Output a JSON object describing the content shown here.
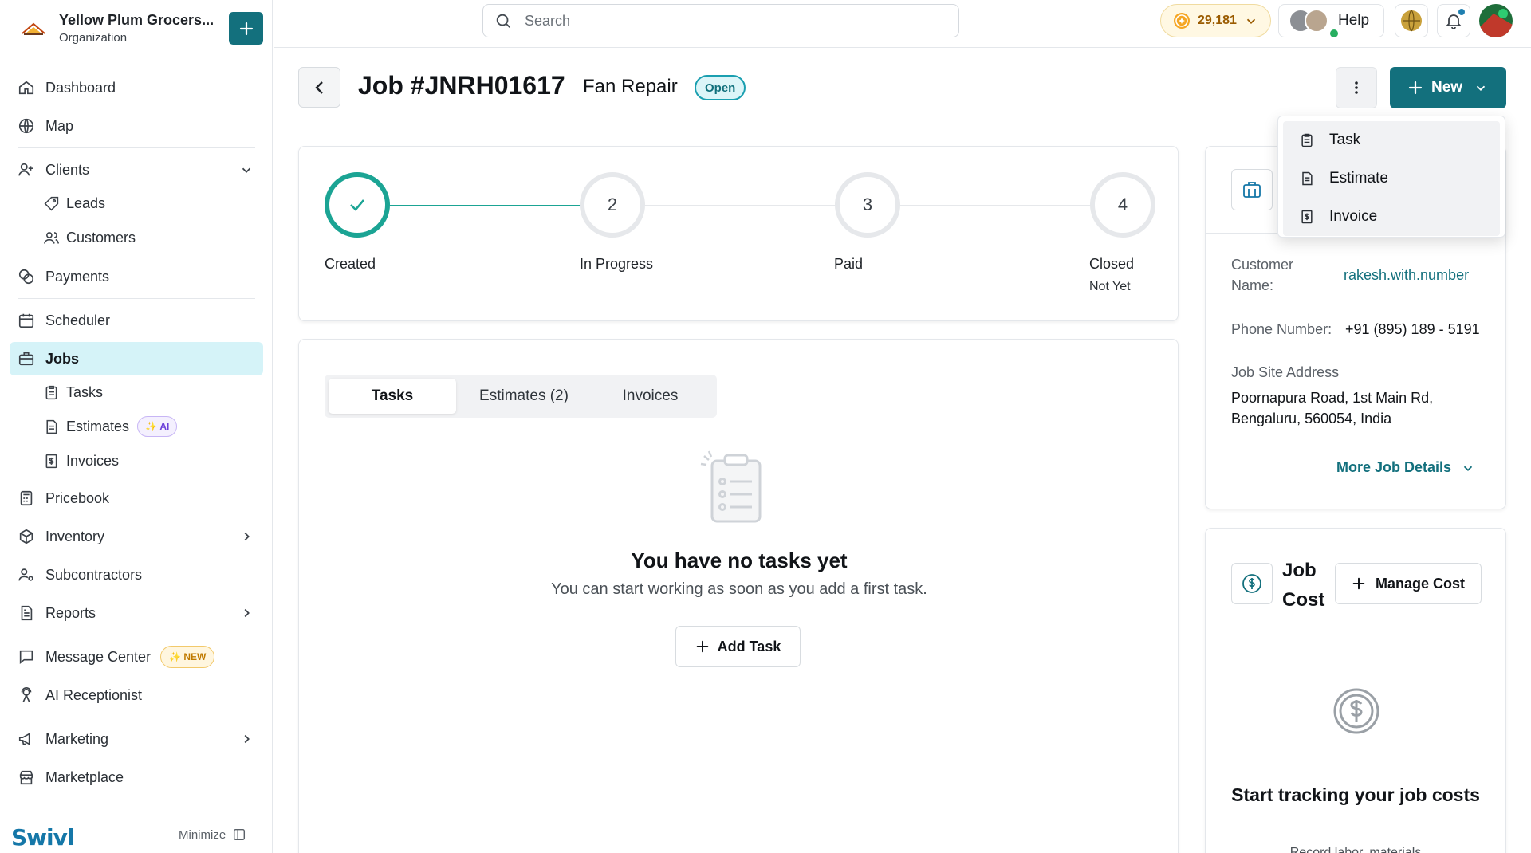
{
  "org": {
    "name": "Yellow Plum Grocers...",
    "type": "Organization"
  },
  "sidebar": {
    "dashboard": "Dashboard",
    "map": "Map",
    "clients": "Clients",
    "leads": "Leads",
    "customers": "Customers",
    "payments": "Payments",
    "scheduler": "Scheduler",
    "jobs": "Jobs",
    "tasks": "Tasks",
    "estimates": "Estimates",
    "estimates_badge": "AI",
    "invoices": "Invoices",
    "pricebook": "Pricebook",
    "inventory": "Inventory",
    "subcontractors": "Subcontractors",
    "reports": "Reports",
    "message_center": "Message Center",
    "message_center_badge": "NEW",
    "ai_receptionist": "AI Receptionist",
    "marketing": "Marketing",
    "marketplace": "Marketplace",
    "brand": "Swivl",
    "minimize": "Minimize"
  },
  "topbar": {
    "search_placeholder": "Search",
    "credits": "29,181",
    "help": "Help"
  },
  "header": {
    "job_title": "Job #JNRH01617",
    "job_subtitle": "Fan Repair",
    "status": "Open",
    "new_button": "New"
  },
  "new_menu": {
    "items": [
      "Task",
      "Estimate",
      "Invoice"
    ]
  },
  "progress": {
    "steps": [
      {
        "number": "",
        "label": "Created",
        "note": ""
      },
      {
        "number": "2",
        "label": "In Progress",
        "note": ""
      },
      {
        "number": "3",
        "label": "Paid",
        "note": ""
      },
      {
        "number": "4",
        "label": "Closed",
        "note": "Not Yet"
      }
    ],
    "completed": 1
  },
  "tabs": [
    "Tasks",
    "Estimates (2)",
    "Invoices"
  ],
  "empty_tasks": {
    "title": "You have no tasks yet",
    "description": "You can start working as soon as you add a first task.",
    "button": "Add Task"
  },
  "customer": {
    "name_label": "Customer Name:",
    "name_value": "rakesh.with.number",
    "phone_label": "Phone Number:",
    "phone_value": "+91 (895) 189 - 5191",
    "address_label": "Job Site Address",
    "address_line1": "Poornapura Road, 1st Main Rd,",
    "address_line2": "Bengaluru, 560054, India",
    "more_details": "More Job Details"
  },
  "job_cost": {
    "title": "Job Cost",
    "manage_button": "Manage Cost",
    "empty_title": "Start tracking your job costs",
    "empty_desc": "Record labor, materials"
  },
  "colors": {
    "accent": "#13707d",
    "success": "#1ba494",
    "active_nav": "#d5f3f8"
  }
}
